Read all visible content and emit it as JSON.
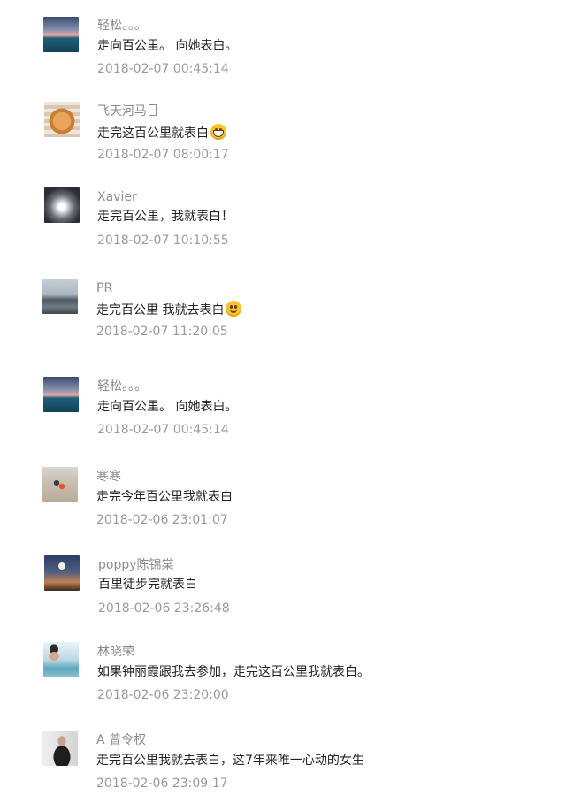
{
  "comments": [
    {
      "name": "轻松。。。",
      "text": "走向百公里。 向她表白。",
      "time": "2018-02-07 00:45:14",
      "avatar": "sunset-sea-avatar"
    },
    {
      "name": "飞天河马",
      "text": "走完这百公里就表白",
      "time": "2018-02-07 08:00:17",
      "avatar": "shiba-dog-avatar",
      "emoji": "grin"
    },
    {
      "name": "Xavier",
      "text": "走完百公里，我就表白！",
      "time": "2018-02-07 10:10:55",
      "avatar": "night-light-avatar"
    },
    {
      "name": "PR",
      "text": "走完百公里 我就去表白",
      "time": "2018-02-07 11:20:05",
      "avatar": "misty-boat-avatar",
      "emoji": "smile"
    },
    {
      "name": "轻松。。。",
      "text": "走向百公里。 向她表白。",
      "time": "2018-02-07 00:45:14",
      "avatar": "sunset-sea-avatar"
    },
    {
      "name": "寒寒",
      "text": "走完今年百公里我就表白",
      "time": "2018-02-06 23:01:07",
      "avatar": "beach-photographer-avatar"
    },
    {
      "name": "poppy陈锦棠",
      "text": "百里徒步完就表白",
      "time": "2018-02-06 23:26:48",
      "avatar": "moon-silhouette-avatar"
    },
    {
      "name": "林晓荣",
      "text": "如果钟丽霞跟我去参加，走完这百公里我就表白。",
      "time": "2018-02-06 23:20:00",
      "avatar": "harbor-portrait-avatar"
    },
    {
      "name": "A 曾令权",
      "text": "走完百公里我就去表白，这7年来唯一心动的女生",
      "time": "2018-02-06 23:09:17",
      "avatar": "suit-portrait-avatar"
    }
  ]
}
